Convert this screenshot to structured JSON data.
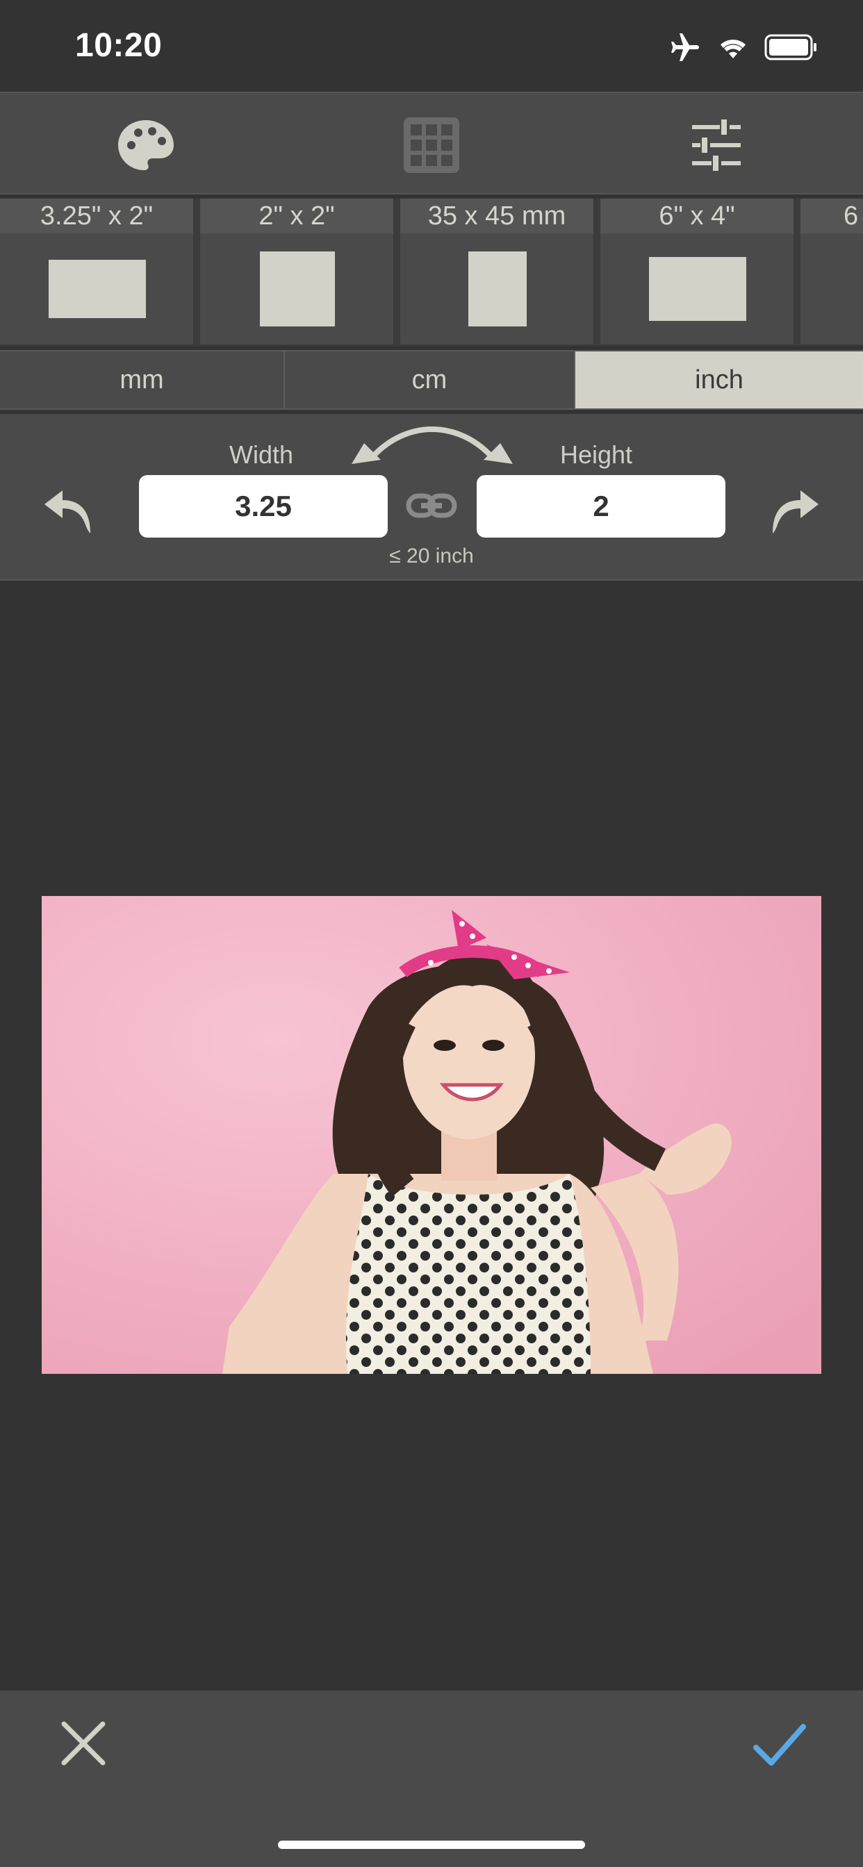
{
  "status_bar": {
    "time": "10:20",
    "icons": [
      "airplane-icon",
      "wifi-icon",
      "battery-icon"
    ]
  },
  "toolbar": {
    "tools": [
      "palette-icon",
      "grid-icon",
      "sliders-icon"
    ]
  },
  "presets": [
    {
      "label": "3.25\" x 2\""
    },
    {
      "label": "2\" x 2\""
    },
    {
      "label": "35 x 45 mm"
    },
    {
      "label": "6\" x 4\""
    },
    {
      "label": "6"
    }
  ],
  "units": {
    "options": [
      "mm",
      "cm",
      "inch"
    ],
    "selected": "inch"
  },
  "dimensions": {
    "width_label": "Width",
    "height_label": "Height",
    "width_value": "3.25",
    "height_value": "2",
    "limit": "≤ 20 inch"
  },
  "colors": {
    "accent": "#5aa9e6",
    "selected_unit": "#d2d2c8",
    "photo_background": "#f0aec2"
  }
}
